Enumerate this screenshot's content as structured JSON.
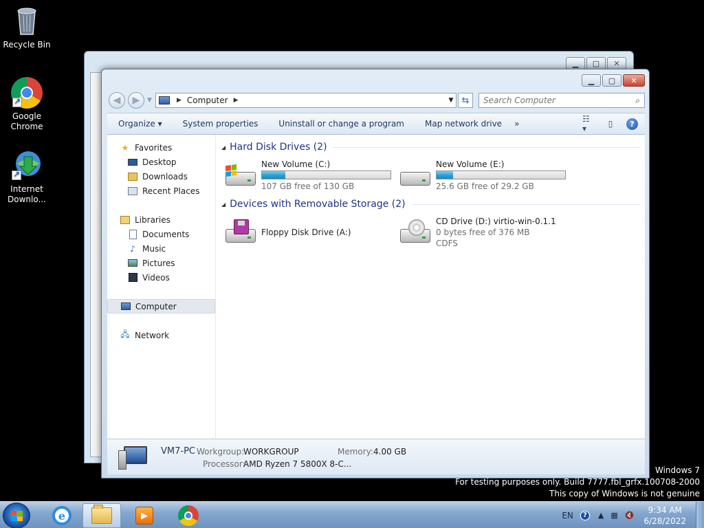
{
  "desktop": {
    "icons": [
      {
        "label": "Recycle Bin"
      },
      {
        "label": "Google Chrome"
      },
      {
        "label": "Internet Downlo..."
      }
    ]
  },
  "window": {
    "address": {
      "segment": "Computer"
    },
    "search": {
      "placeholder": "Search Computer"
    },
    "toolbar": {
      "organize": "Organize ▾",
      "system_properties": "System properties",
      "uninstall": "Uninstall or change a program",
      "map_drive": "Map network drive",
      "more": "»"
    },
    "nav": {
      "favorites": "Favorites",
      "desktop": "Desktop",
      "downloads": "Downloads",
      "recent_places": "Recent Places",
      "libraries": "Libraries",
      "documents": "Documents",
      "music": "Music",
      "pictures": "Pictures",
      "videos": "Videos",
      "computer": "Computer",
      "network": "Network"
    },
    "groups": {
      "hdd_header": "Hard Disk Drives (2)",
      "removable_header": "Devices with Removable Storage (2)"
    },
    "drives": {
      "c": {
        "name": "New Volume (C:)",
        "free": "107 GB free of 130 GB",
        "used_fraction": 0.18
      },
      "e": {
        "name": "New Volume (E:)",
        "free": "25.6 GB free of 29.2 GB",
        "used_fraction": 0.13
      },
      "a": {
        "name": "Floppy Disk Drive (A:)"
      },
      "d": {
        "name": "CD Drive (D:) virtio-win-0.1.1",
        "free": "0 bytes free of 376 MB",
        "fs": "CDFS"
      }
    },
    "details": {
      "pc_name": "VM7-PC",
      "workgroup_label": "Workgroup:",
      "workgroup_value": "WORKGROUP",
      "memory_label": "Memory:",
      "memory_value": "4.00 GB",
      "processor_label": "Processor:",
      "processor_value": "AMD Ryzen 7 5800X 8-C..."
    }
  },
  "watermark": {
    "line1": "Windows 7",
    "line2": "For testing purposes only. Build 7777.fbl_grfx.100708-2000",
    "line3": "This copy of Windows is not genuine"
  },
  "taskbar": {
    "lang": "EN",
    "time": "9:34 AM",
    "date": "6/28/2022"
  }
}
